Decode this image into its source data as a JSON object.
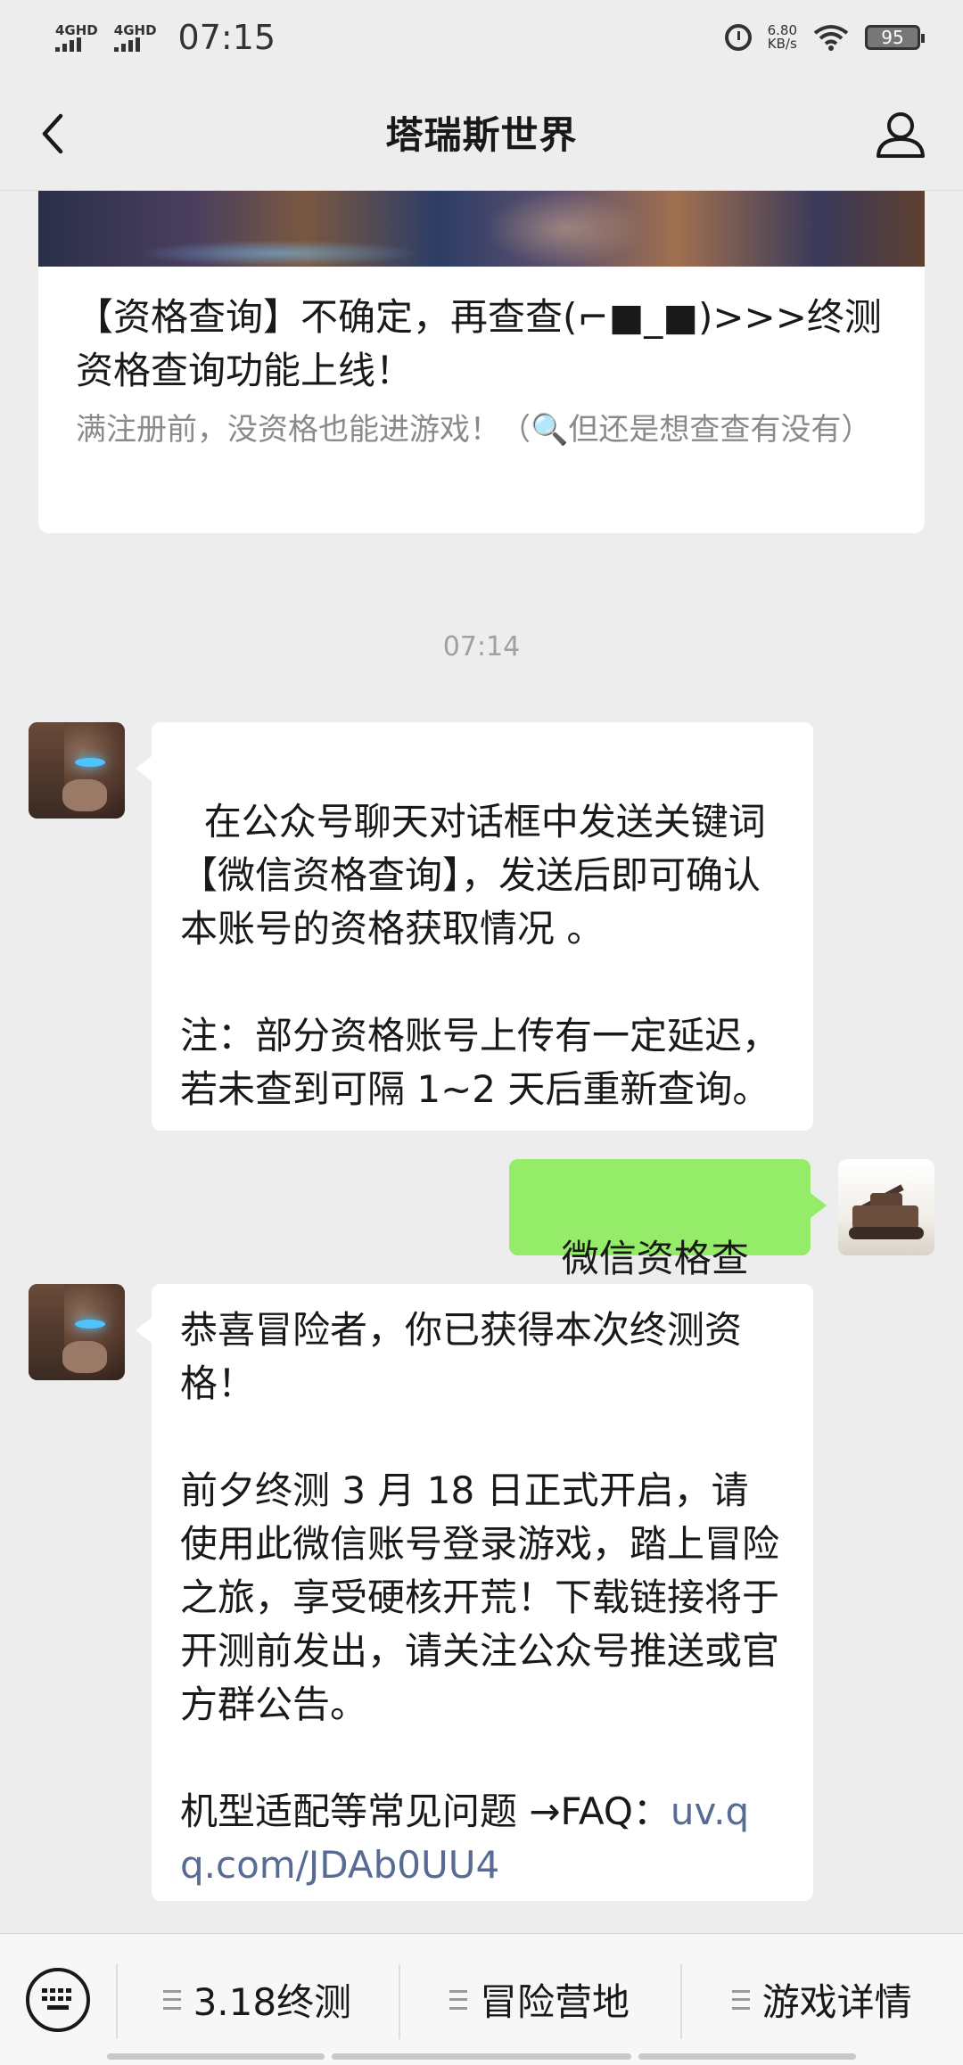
{
  "status_bar": {
    "signal1": "4GHD",
    "signal2": "4GHD",
    "time": "07:15",
    "net_speed_value": "6.80",
    "net_speed_unit": "KB/s",
    "battery": "95"
  },
  "nav": {
    "title": "塔瑞斯世界"
  },
  "article": {
    "title": "【资格查询】不确定，再查查(⌐■_■)>>>终测资格查询功能上线！",
    "description": "满注册前，没资格也能进游戏！（🔍但还是想查查有没有）"
  },
  "chat": {
    "timestamp": "07:14",
    "messages": [
      {
        "from": "official",
        "text": "在公众号聊天对话框中发送关键词【微信资格查询】，发送后即可确认本账号的资格获取情况 。\n\n注：部分资格账号上传有一定延迟，若未查到可隔 1~2 天后重新查询。"
      },
      {
        "from": "user",
        "text": "微信资格查询"
      },
      {
        "from": "official",
        "text": "恭喜冒险者，你已获得本次终测资格！\n\n前夕终测 3 月 18 日正式开启，请使用此微信账号登录游戏，踏上冒险之旅，享受硬核开荒！下载链接将于开测前发出，请关注公众号推送或官方群公告。\n\n机型适配等常见问题 →FAQ：",
        "link": "uv.qq.com/JDAb0UU4"
      }
    ]
  },
  "bottom_menu": {
    "items": [
      {
        "label": "3.18终测"
      },
      {
        "label": "冒险营地"
      },
      {
        "label": "游戏详情"
      }
    ]
  },
  "colors": {
    "background": "#ededed",
    "user_bubble": "#95ec69",
    "link": "#576b95"
  }
}
